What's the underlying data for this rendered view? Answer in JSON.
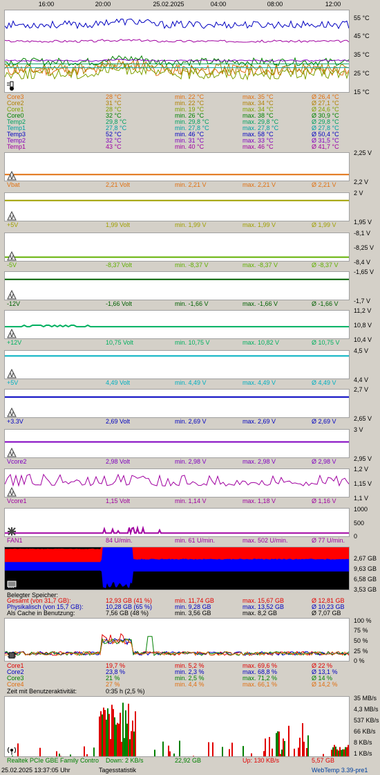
{
  "time_axis": [
    "16:00",
    "20:00",
    "25.02.2025",
    "04:00",
    "08:00",
    "12:00"
  ],
  "temp": {
    "scale": [
      "55 °C",
      "45 °C",
      "35 °C",
      "25 °C",
      "15 °C"
    ],
    "rows": [
      {
        "name": "Core3",
        "cur": "28 °C",
        "min": "min. 22 °C",
        "max": "max. 35 °C",
        "avg": "Ø 26,4 °C",
        "color": "#e07010"
      },
      {
        "name": "Core2",
        "cur": "31 °C",
        "min": "min. 22 °C",
        "max": "max. 34 °C",
        "avg": "Ø 27,1 °C",
        "color": "#b08000"
      },
      {
        "name": "Core1",
        "cur": "28 °C",
        "min": "min. 19 °C",
        "max": "max. 34 °C",
        "avg": "Ø 24,6 °C",
        "color": "#80a000"
      },
      {
        "name": "Core0",
        "cur": "32 °C",
        "min": "min. 26 °C",
        "max": "max. 38 °C",
        "avg": "Ø 30,9 °C",
        "color": "#008000"
      },
      {
        "name": "Temp2",
        "cur": "29,8 °C",
        "min": "min. 29,8 °C",
        "max": "max. 29,8 °C",
        "avg": "Ø 29,8 °C",
        "color": "#00a060"
      },
      {
        "name": "Temp1",
        "cur": "27,8 °C",
        "min": "min. 27,8 °C",
        "max": "max. 27,8 °C",
        "avg": "Ø 27,8 °C",
        "color": "#00a0a0"
      },
      {
        "name": "Temp3",
        "cur": "52 °C",
        "min": "min. 46 °C",
        "max": "max. 58 °C",
        "avg": "Ø 50,4 °C",
        "color": "#0000c0"
      },
      {
        "name": "Temp2",
        "cur": "32 °C",
        "min": "min. 31 °C",
        "max": "max. 33 °C",
        "avg": "Ø 31,5 °C",
        "color": "#8000c0"
      },
      {
        "name": "Temp1",
        "cur": "43 °C",
        "min": "min. 40 °C",
        "max": "max. 46 °C",
        "avg": "Ø 41,7 °C",
        "color": "#a000a0"
      }
    ]
  },
  "volt": [
    {
      "name": "Vbat",
      "cur": "2,21 Volt",
      "min": "min. 2,21 V",
      "max": "max. 2,21 V",
      "avg": "Ø 2,21 V",
      "color": "#e07010",
      "scale": [
        "2,25 V",
        "2,2 V"
      ]
    },
    {
      "name": "+5V",
      "cur": "1,99 Volt",
      "min": "min. 1,99 V",
      "max": "max. 1,99 V",
      "avg": "Ø 1,99 V",
      "color": "#a0a000",
      "scale": [
        "2 V",
        "1,95 V"
      ]
    },
    {
      "name": "-5V",
      "cur": "-8,37 Volt",
      "min": "min. -8,37 V",
      "max": "max. -8,37 V",
      "avg": "Ø -8,37 V",
      "color": "#60b000",
      "scale": [
        "-8,1 V",
        "-8,25 V",
        "-8,4 V"
      ]
    },
    {
      "name": "-12V",
      "cur": "-1,66 Volt",
      "min": "min. -1,66 V",
      "max": "max. -1,66 V",
      "avg": "Ø -1,66 V",
      "color": "#006000",
      "scale": [
        "-1,65 V",
        "-1,7 V"
      ]
    },
    {
      "name": "+12V",
      "cur": "10,75 Volt",
      "min": "min. 10,75 V",
      "max": "max. 10,82 V",
      "avg": "Ø 10,75 V",
      "color": "#00b060",
      "scale": [
        "11,2 V",
        "10,8 V",
        "10,4 V"
      ]
    },
    {
      "name": "+5V",
      "cur": "4,49 Volt",
      "min": "min. 4,49 V",
      "max": "max. 4,49 V",
      "avg": "Ø 4,49 V",
      "color": "#00b0c0",
      "scale": [
        "4,5 V",
        "4,4 V"
      ]
    },
    {
      "name": "+3.3V",
      "cur": "2,69 Volt",
      "min": "min. 2,69 V",
      "max": "max. 2,69 V",
      "avg": "Ø 2,69 V",
      "color": "#0000c0",
      "scale": [
        "2,7 V",
        "2,65 V"
      ]
    },
    {
      "name": "Vcore2",
      "cur": "2,98 Volt",
      "min": "min. 2,98 V",
      "max": "max. 2,98 V",
      "avg": "Ø 2,98 V",
      "color": "#8000c0",
      "scale": [
        "3 V",
        "2,95 V"
      ]
    },
    {
      "name": "Vcore1",
      "cur": "1,15 Volt",
      "min": "min. 1,14 V",
      "max": "max. 1,18 V",
      "avg": "Ø 1,16 V",
      "color": "#a000a0",
      "scale": [
        "1,2 V",
        "1,15 V",
        "1,1 V"
      ]
    }
  ],
  "fan": {
    "name": "FAN1",
    "cur": "84 U/min.",
    "min": "min. 61 U/min.",
    "max": "max. 502 U/min.",
    "avg": "Ø 77 U/min.",
    "color": "#a000a0",
    "scale": [
      "1000",
      "500",
      "0"
    ]
  },
  "mem": {
    "scale": [
      "2,67 GB",
      "9,63 GB",
      "6,58 GB",
      "3,53 GB"
    ],
    "title": "Belegter Speicher:",
    "rows": [
      {
        "name": "Gesamt (von 31,7 GB):",
        "cur": "12,93 GB (41 %)",
        "min": "min. 11,74 GB",
        "max": "max. 15,67 GB",
        "avg": "Ø 12,81 GB",
        "color": "#e00000"
      },
      {
        "name": "Physikalisch (von 15,7 GB):",
        "cur": "10,28 GB (65 %)",
        "min": "min. 9,28 GB",
        "max": "max. 13,52 GB",
        "avg": "Ø 10,23 GB",
        "color": "#0000c0"
      },
      {
        "name": "Als Cache in Benutzung:",
        "cur": "7,56 GB (48 %)",
        "min": "min. 3,56 GB",
        "max": "max. 8,2 GB",
        "avg": "Ø 7,07 GB",
        "color": "#000000"
      }
    ]
  },
  "cpu": {
    "scale": [
      "100 %",
      "75 %",
      "50 %",
      "25 %",
      "0 %"
    ],
    "rows": [
      {
        "name": "Core1",
        "cur": "19,7 %",
        "min": "min. 5,2 %",
        "max": "max. 69,6 %",
        "avg": "Ø 22 %",
        "color": "#e00000"
      },
      {
        "name": "Core2",
        "cur": "23,8 %",
        "min": "min. 2,3 %",
        "max": "max. 68,8 %",
        "avg": "Ø 13,1 %",
        "color": "#0000c0"
      },
      {
        "name": "Core3",
        "cur": "21 %",
        "min": "min. 2,5 %",
        "max": "max. 71,2 %",
        "avg": "Ø 14 %",
        "color": "#008000"
      },
      {
        "name": "Core4",
        "cur": "27 %",
        "min": "min. 4,4 %",
        "max": "max. 66,1 %",
        "avg": "Ø 14,2 %",
        "color": "#e07010"
      }
    ],
    "activity_label": "Zeit mit Benutzeraktivität:",
    "activity_value": "0:35 h (2,5 %)"
  },
  "net": {
    "scale": [
      "35 MB/s",
      "4,3 MB/s",
      "537 KB/s",
      "66 KB/s",
      "8 KB/s",
      "1 KB/s"
    ],
    "name": "Realtek PCIe GBE Family Contro",
    "down": "Down: 2 KB/s",
    "down_total": "22,92 GB",
    "up": "Up: 130 KB/s",
    "up_total": "5,57 GB"
  },
  "footer": {
    "timestamp": "25.02.2025 13:37:05 Uhr",
    "mode": "Tagesstatistik",
    "version": "WebTemp 3.39-pre1"
  }
}
